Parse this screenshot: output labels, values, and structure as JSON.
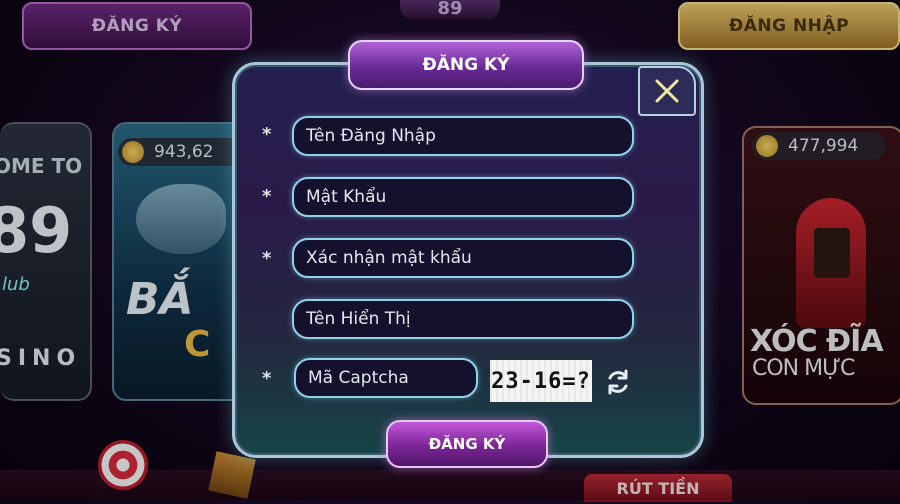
{
  "background": {
    "top_register_label": "ĐĂNG KÝ",
    "top_login_label": "ĐĂNG NHẬP",
    "logo_fragment": "89",
    "left_card": {
      "welcome": "OME TO",
      "number": "89",
      "club": "lub",
      "casino": "SINO"
    },
    "mid_card": {
      "jackpot": "943,62",
      "title": "BẮ",
      "title2": "C"
    },
    "right_card": {
      "jackpot": "477,994",
      "title": "XÓC ĐĨA",
      "subtitle": "CON MỰC"
    },
    "bottom_button": "RÚT TIỀN"
  },
  "modal": {
    "title": "ĐĂNG KÝ",
    "required_mark": "*",
    "fields": {
      "username_placeholder": "Tên Đăng Nhập",
      "password_placeholder": "Mật Khẩu",
      "confirm_placeholder": "Xác nhận mật khẩu",
      "display_name_placeholder": "Tên Hiển Thị",
      "captcha_placeholder": "Mã Captcha"
    },
    "captcha_text": "23-16=?",
    "submit_label": "ĐĂNG KÝ",
    "icons": {
      "close": "close-icon",
      "refresh": "refresh-icon"
    }
  },
  "colors": {
    "accent_purple": "#8b36b3",
    "field_border": "#8fd3ea",
    "frame_border": "#a9c7d6"
  }
}
